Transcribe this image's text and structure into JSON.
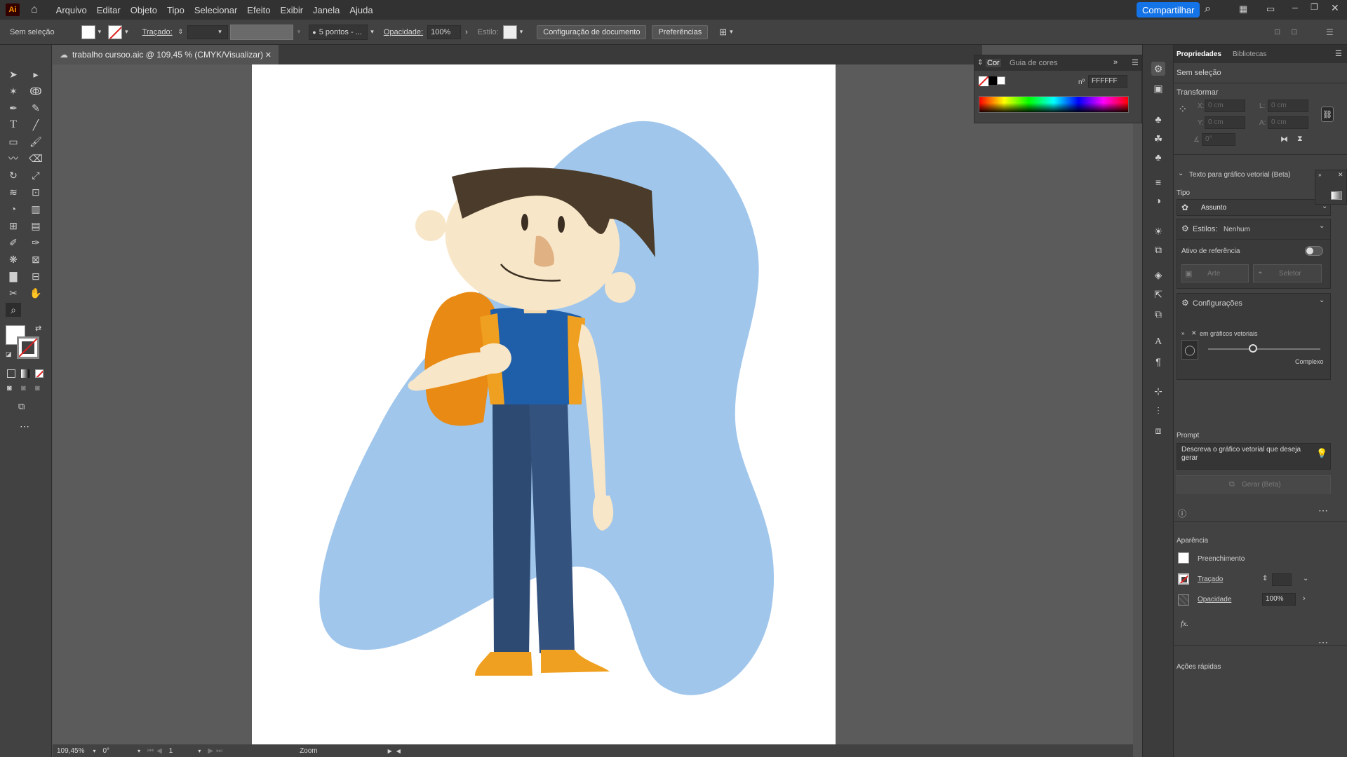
{
  "app": {
    "logo": "Ai"
  },
  "menu": [
    "Arquivo",
    "Editar",
    "Objeto",
    "Tipo",
    "Selecionar",
    "Efeito",
    "Exibir",
    "Janela",
    "Ajuda"
  ],
  "share_label": "Compartilhar",
  "control": {
    "selection": "Sem seleção",
    "stroke_label": "Traçado:",
    "brush": "5 pontos - ...",
    "opacity_label": "Opacidade:",
    "opacity_value": "100%",
    "style_label": "Estilo:",
    "doc_setup": "Configuração de documento",
    "prefs": "Preferências"
  },
  "document": {
    "tab_title": "trabalho cursoo.aic @ 109,45 % (CMYK/Visualizar)"
  },
  "status": {
    "zoom": "109,45%",
    "rotation": "0°",
    "artboard": "1",
    "tool": "Zoom"
  },
  "color_panel": {
    "tab1": "Cor",
    "tab2": "Guia de cores",
    "hex_label": "nº",
    "hex_value": "FFFFFF"
  },
  "properties": {
    "tab1": "Propriedades",
    "tab2": "Bibliotecas",
    "no_selection": "Sem seleção",
    "transform": "Transformar",
    "x": "X:",
    "y": "Y:",
    "w": "L:",
    "h": "A:",
    "x_val": "0 cm",
    "y_val": "0 cm",
    "w_val": "0 cm",
    "h_val": "0 cm",
    "angle": "0°",
    "text_to_vector": "Texto para gráfico vetorial (Beta)",
    "tipo": "Tipo",
    "assunto": "Assunto",
    "estilos": "Estilos:",
    "estilos_val": "Nenhum",
    "ref_asset": "Ativo de referência",
    "arte": "Arte",
    "seletor": "Seletor",
    "configuracoes": "Configurações",
    "graficos_vetoriais": "em gráficos vetoriais",
    "complexo": "Complexo",
    "prompt": "Prompt",
    "prompt_placeholder": "Descreva o gráfico vetorial que deseja gerar",
    "gerar": "Gerar (Beta)",
    "aparencia": "Aparência",
    "preenchimento": "Preenchimento",
    "tracado": "Traçado",
    "opacidade": "Opacidade",
    "opacidade_val": "100%",
    "fx": "fx.",
    "acoes_rapidas": "Ações rápidas"
  },
  "colors": {
    "accent": "#1473e6",
    "blob": "#a0c6eb",
    "skin": "#f8e6c8",
    "hair": "#4a3b2a",
    "backpack": "#e88a14",
    "shirt": "#1f5ea8",
    "pants": "#2d4a73",
    "shoes": "#f0a020"
  }
}
